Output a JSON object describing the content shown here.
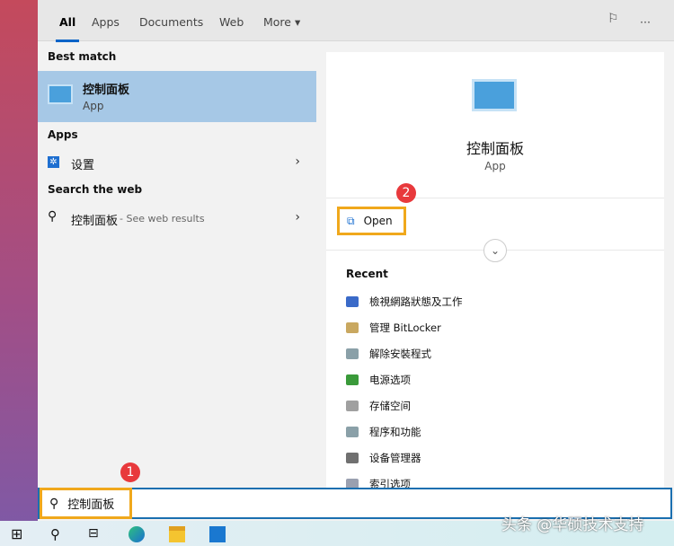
{
  "tabs": {
    "all": "All",
    "apps": "Apps",
    "documents": "Documents",
    "web": "Web",
    "more": "More ▾"
  },
  "header_icons": {
    "feedback": "feedback-icon",
    "more": "···"
  },
  "left": {
    "best_match_heading": "Best match",
    "best_match": {
      "title": "控制面板",
      "subtitle": "App"
    },
    "apps_heading": "Apps",
    "apps": [
      {
        "label": "设置"
      }
    ],
    "web_heading": "Search the web",
    "web": {
      "query": "控制面板",
      "suffix": " - See web results"
    }
  },
  "right": {
    "title": "控制面板",
    "subtitle": "App",
    "open_label": "Open",
    "recent_heading": "Recent",
    "recent": [
      {
        "label": "檢視網路狀態及工作",
        "color": "#3a6ac8"
      },
      {
        "label": "管理 BitLocker",
        "color": "#c9a860"
      },
      {
        "label": "解除安裝程式",
        "color": "#8aa0a8"
      },
      {
        "label": "电源选项",
        "color": "#3a9a3a"
      },
      {
        "label": "存储空间",
        "color": "#a0a0a0"
      },
      {
        "label": "程序和功能",
        "color": "#8aa0a8"
      },
      {
        "label": "设备管理器",
        "color": "#707070"
      },
      {
        "label": "索引选项",
        "color": "#9aa0b0"
      }
    ]
  },
  "badges": {
    "one": "1",
    "two": "2"
  },
  "search": {
    "value": "控制面板"
  },
  "watermark": "头条 @华硕技术支持"
}
